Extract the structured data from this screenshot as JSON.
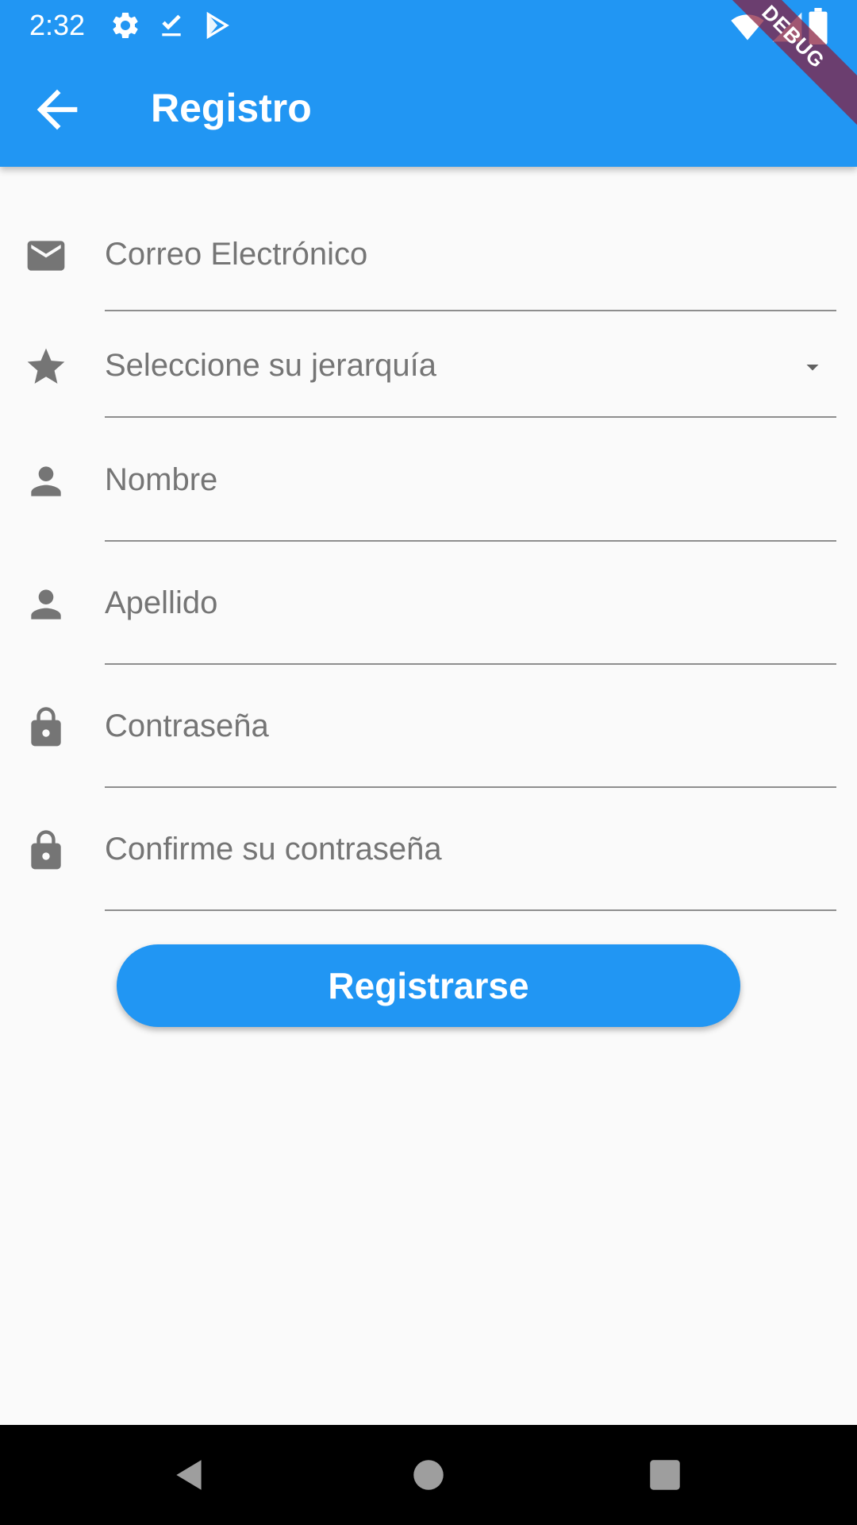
{
  "status_bar": {
    "time": "2:32",
    "left_icons": [
      "settings-icon",
      "download-done-icon",
      "play-store-icon"
    ],
    "right_icons": [
      "wifi-icon",
      "signal-icon",
      "battery-icon"
    ]
  },
  "app_bar": {
    "title": "Registro",
    "back_icon": "arrow-back-icon"
  },
  "debug_banner": "DEBUG",
  "form": {
    "email": {
      "placeholder": "Correo Electrónico",
      "icon": "mail-icon"
    },
    "hierarchy": {
      "placeholder": "Seleccione su jerarquía",
      "icon": "star-icon"
    },
    "first_name": {
      "placeholder": "Nombre",
      "icon": "person-icon"
    },
    "last_name": {
      "placeholder": "Apellido",
      "icon": "person-icon"
    },
    "password": {
      "placeholder": "Contraseña",
      "icon": "lock-icon"
    },
    "confirm_password": {
      "placeholder": "Confirme su contraseña",
      "icon": "lock-icon"
    }
  },
  "register_button": {
    "label": "Registrarse"
  },
  "colors": {
    "primary": "#2196f3",
    "background": "#fafafa",
    "hint_text": "#757575",
    "icon": "#757575",
    "nav_bar": "#000000"
  }
}
